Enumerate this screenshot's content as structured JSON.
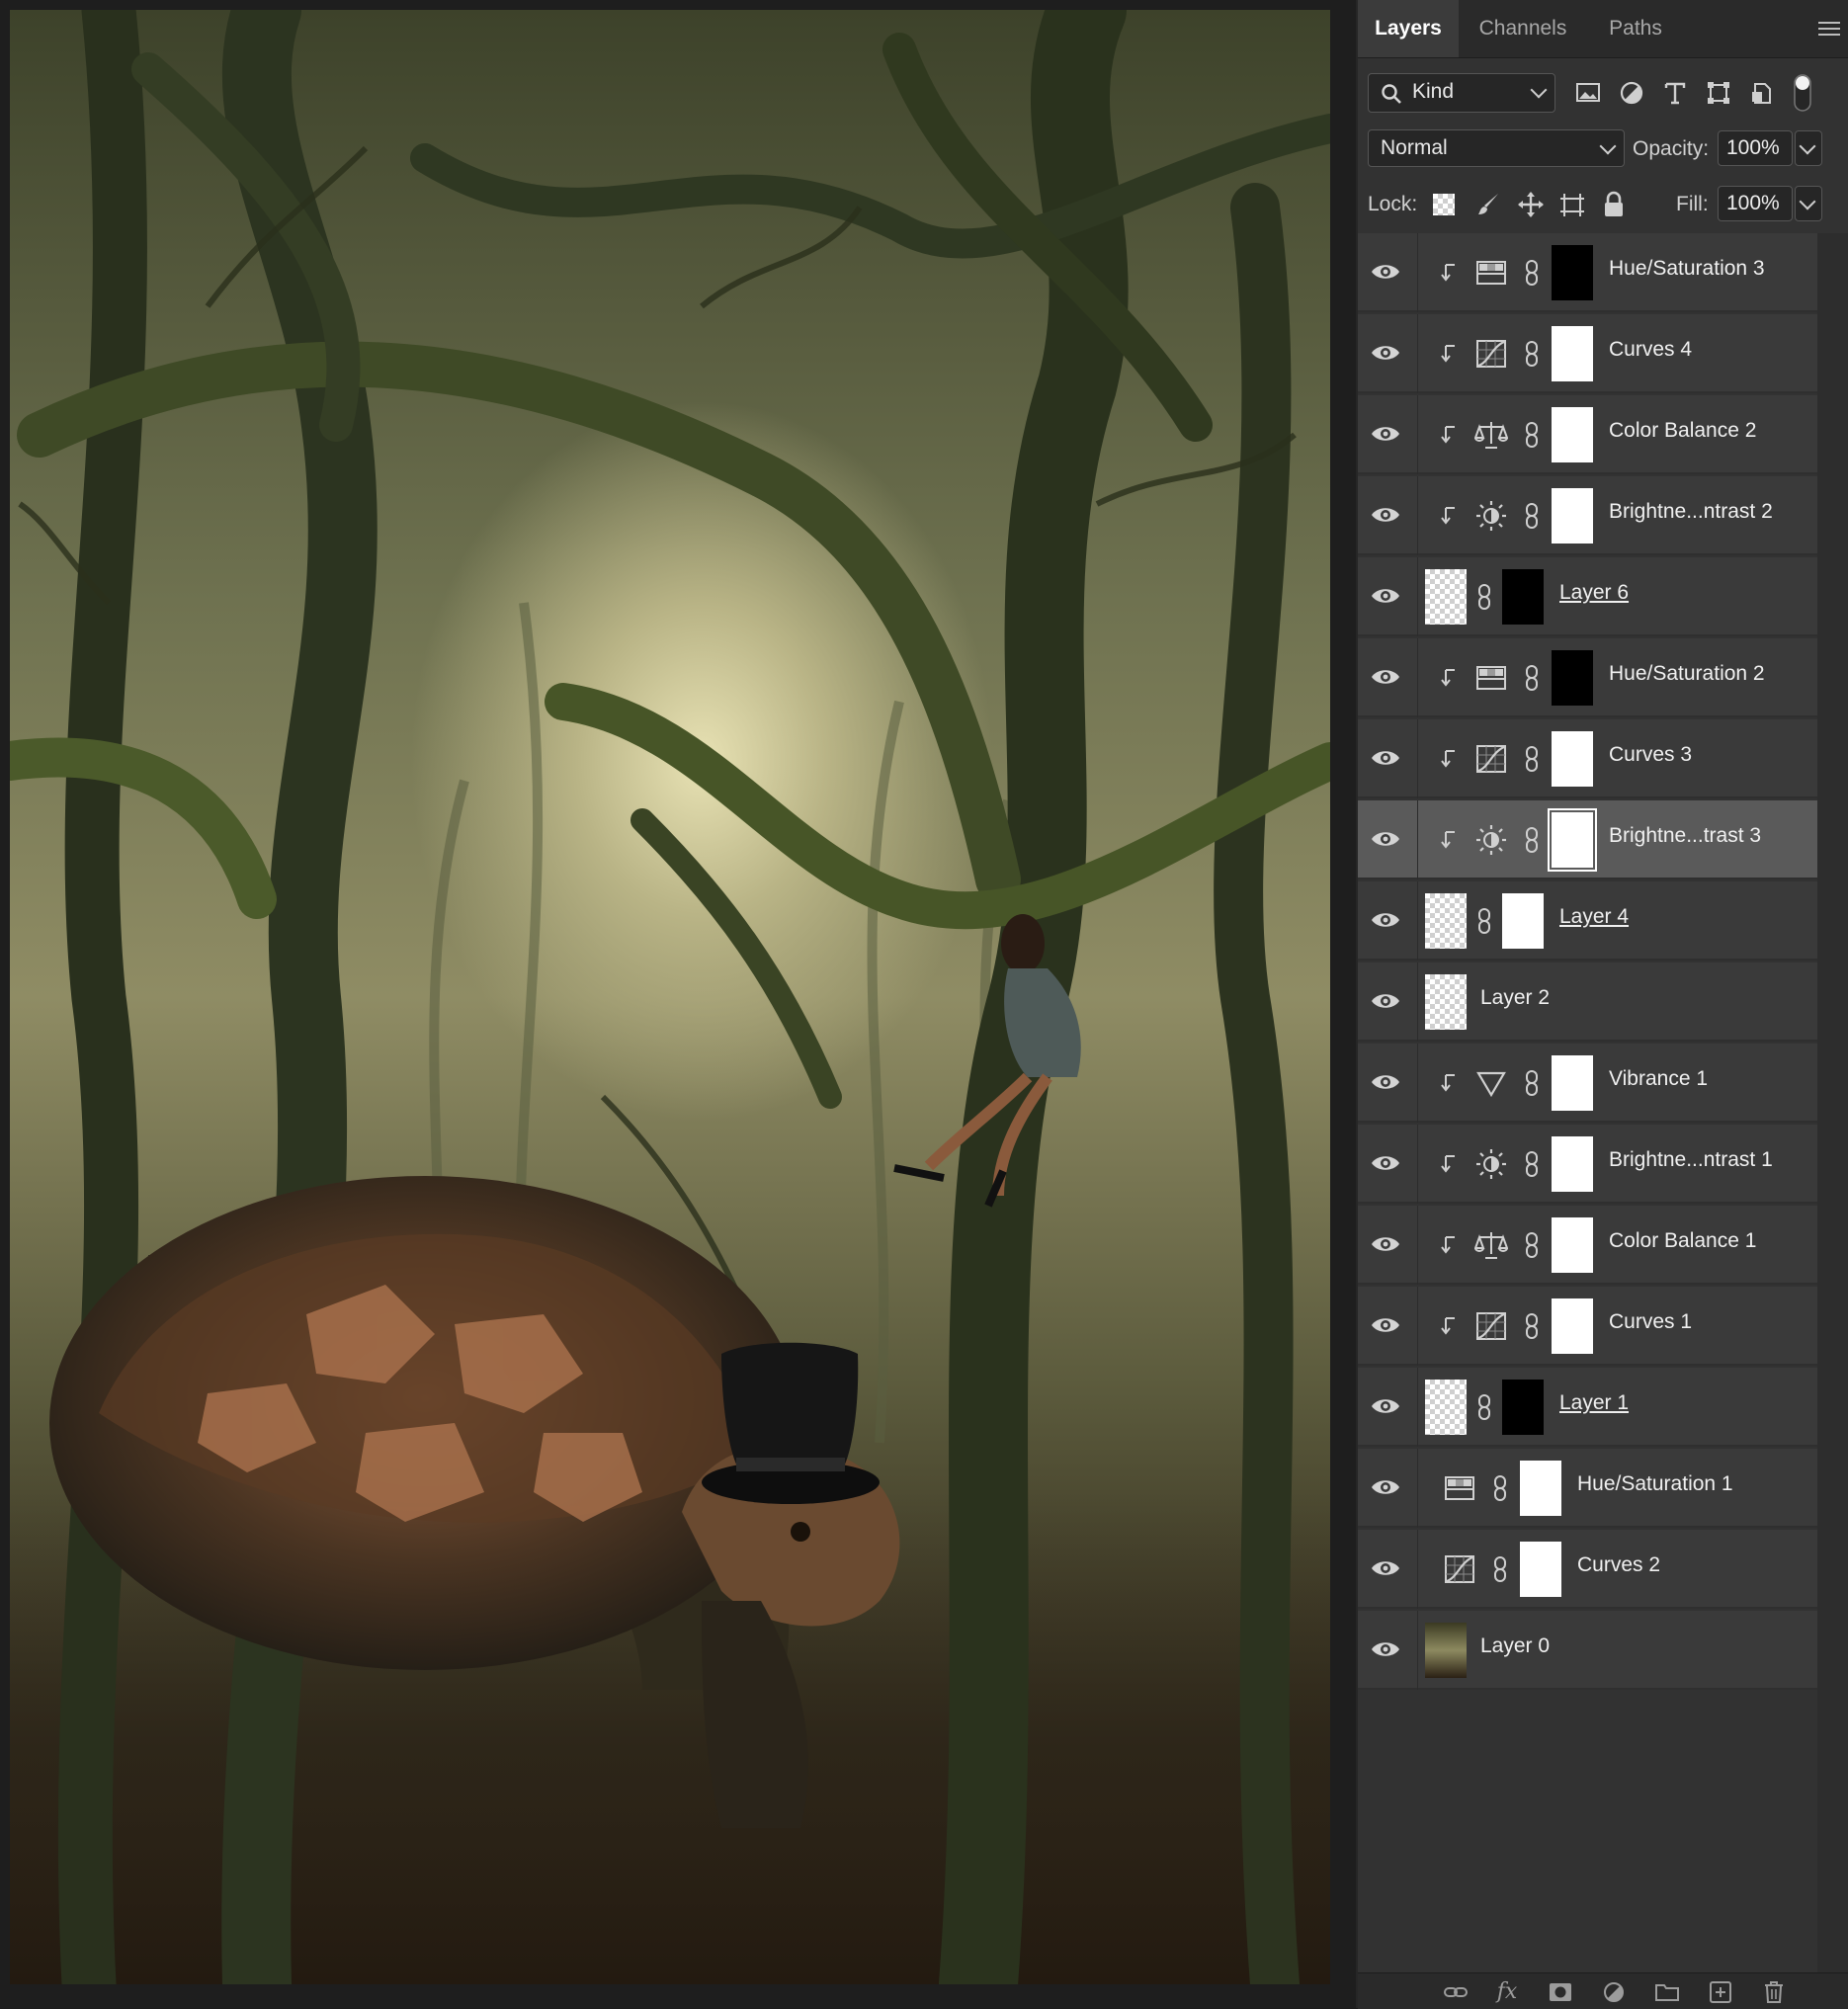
{
  "panel": {
    "tabs": [
      {
        "label": "Layers",
        "active": true
      },
      {
        "label": "Channels",
        "active": false
      },
      {
        "label": "Paths",
        "active": false
      }
    ],
    "filter": {
      "icon": "search-icon",
      "value": "Kind"
    },
    "filter_icons": [
      "image-filter-icon",
      "adjustment-filter-icon",
      "type-filter-icon",
      "shape-filter-icon",
      "smart-object-filter-icon",
      "filter-toggle-icon"
    ],
    "blend_mode": "Normal",
    "opacity_label": "Opacity:",
    "opacity_value": "100%",
    "lock_label": "Lock:",
    "lock_icons": [
      "lock-transparent-icon",
      "lock-paint-icon",
      "lock-position-icon",
      "lock-artboard-icon",
      "lock-all-icon"
    ],
    "fill_label": "Fill:",
    "fill_value": "100%"
  },
  "layers": [
    {
      "name": "Hue/Saturation 3",
      "type": "hue-saturation",
      "clipped": true,
      "mask": "black",
      "selected": false
    },
    {
      "name": "Curves 4",
      "type": "curves",
      "clipped": true,
      "mask": "white",
      "selected": false
    },
    {
      "name": "Color Balance 2",
      "type": "color-balance",
      "clipped": true,
      "mask": "white",
      "selected": false
    },
    {
      "name": "Brightne...ntrast 2",
      "type": "brightness-contrast",
      "clipped": true,
      "mask": "white",
      "selected": false
    },
    {
      "name": "Layer 6",
      "type": "pixel",
      "clipped": false,
      "mask": "black",
      "selected": false
    },
    {
      "name": "Hue/Saturation 2",
      "type": "hue-saturation",
      "clipped": true,
      "mask": "black",
      "selected": false
    },
    {
      "name": "Curves 3",
      "type": "curves",
      "clipped": true,
      "mask": "white",
      "selected": false
    },
    {
      "name": "Brightne...trast 3",
      "type": "brightness-contrast",
      "clipped": true,
      "mask": "white",
      "selected": true
    },
    {
      "name": "Layer 4",
      "type": "pixel",
      "clipped": false,
      "mask": "white",
      "selected": false
    },
    {
      "name": "Layer 2",
      "type": "pixel-plain",
      "clipped": false,
      "mask": "none",
      "selected": false
    },
    {
      "name": "Vibrance 1",
      "type": "vibrance",
      "clipped": true,
      "mask": "white",
      "selected": false
    },
    {
      "name": "Brightne...ntrast 1",
      "type": "brightness-contrast",
      "clipped": true,
      "mask": "white",
      "selected": false
    },
    {
      "name": "Color Balance 1",
      "type": "color-balance",
      "clipped": true,
      "mask": "white",
      "selected": false
    },
    {
      "name": "Curves 1",
      "type": "curves",
      "clipped": true,
      "mask": "white",
      "selected": false
    },
    {
      "name": "Layer 1",
      "type": "pixel",
      "clipped": false,
      "mask": "black",
      "selected": false
    },
    {
      "name": "Hue/Saturation 1",
      "type": "hue-saturation",
      "clipped": false,
      "mask": "white",
      "selected": false
    },
    {
      "name": "Curves 2",
      "type": "curves",
      "clipped": false,
      "mask": "white",
      "selected": false
    },
    {
      "name": "Layer 0",
      "type": "background-image",
      "clipped": false,
      "mask": "none",
      "selected": false
    }
  ],
  "bottom_icons": [
    "link-layers-icon",
    "fx-icon",
    "add-mask-icon",
    "new-adjustment-icon",
    "new-group-icon",
    "new-layer-icon",
    "delete-icon"
  ],
  "bottom_fx_text": "fx",
  "colors": {
    "panel_bg": "#323232",
    "row_bg": "#3a3a3a",
    "row_selected": "#5a5a5a",
    "tab_bar": "#2a2a2a"
  }
}
